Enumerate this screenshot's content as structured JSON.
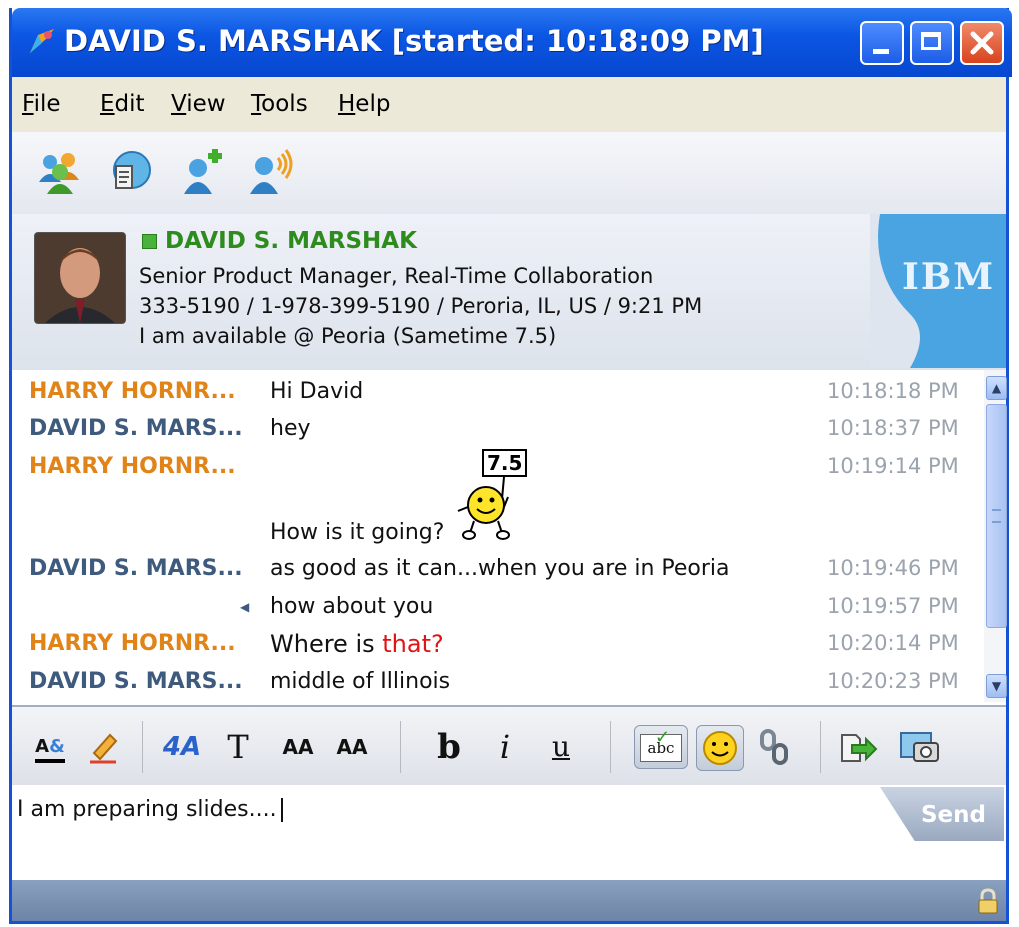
{
  "window": {
    "title": "DAVID S. MARSHAK [started: 10:18:09 PM]"
  },
  "menu": [
    {
      "label": "File",
      "underline": "F",
      "rest": "ile"
    },
    {
      "label": "Edit",
      "underline": "E",
      "rest": "dit"
    },
    {
      "label": "View",
      "underline": "V",
      "rest": "iew"
    },
    {
      "label": "Tools",
      "underline": "T",
      "rest": "ools"
    },
    {
      "label": "Help",
      "underline": "H",
      "rest": "elp"
    }
  ],
  "contact": {
    "name": "DAVID S. MARSHAK",
    "title_line": "Senior Product Manager, Real-Time Collaboration",
    "contact_line": "333-5190 / 1-978-399-5190 / Peroria, IL, US / 9:21 PM",
    "status_line": "I am available  @ Peoria (Sametime 7.5)",
    "status_color": "#49b23a",
    "brand": "IBM"
  },
  "messages": [
    {
      "sender": "HARRY HORNR...",
      "text": "Hi David",
      "time": "10:18:18 PM"
    },
    {
      "sender": "DAVID S. MARS...",
      "text": "hey",
      "time": "10:18:37 PM"
    },
    {
      "sender": "HARRY HORNR...",
      "text": "How is it going?",
      "time": "10:19:14 PM",
      "emoticon_sign": "7.5"
    },
    {
      "sender": "DAVID S. MARS...",
      "text": "as good as it can...when you are in Peoria",
      "time": "10:19:46 PM"
    },
    {
      "sender": "",
      "text": "how about you",
      "time": "10:19:57 PM"
    },
    {
      "sender": "HARRY HORNR...",
      "text_a": "Where is ",
      "text_b": "that?",
      "time": "10:20:14 PM"
    },
    {
      "sender": "DAVID S. MARS...",
      "text": "middle of Illinois",
      "time": "10:20:23 PM"
    }
  ],
  "format_toolbar": {
    "bold": "b",
    "italic": "i",
    "underline": "u",
    "font": "T",
    "grow": "AA",
    "shrink": "AA",
    "spell": "abc"
  },
  "input": {
    "value": "I am preparing slides....",
    "send_label": "Send"
  },
  "colors": {
    "accent": "#0b56e3",
    "harry": "#e0841a",
    "david": "#3e5a7d",
    "highlight": "#e01414"
  }
}
